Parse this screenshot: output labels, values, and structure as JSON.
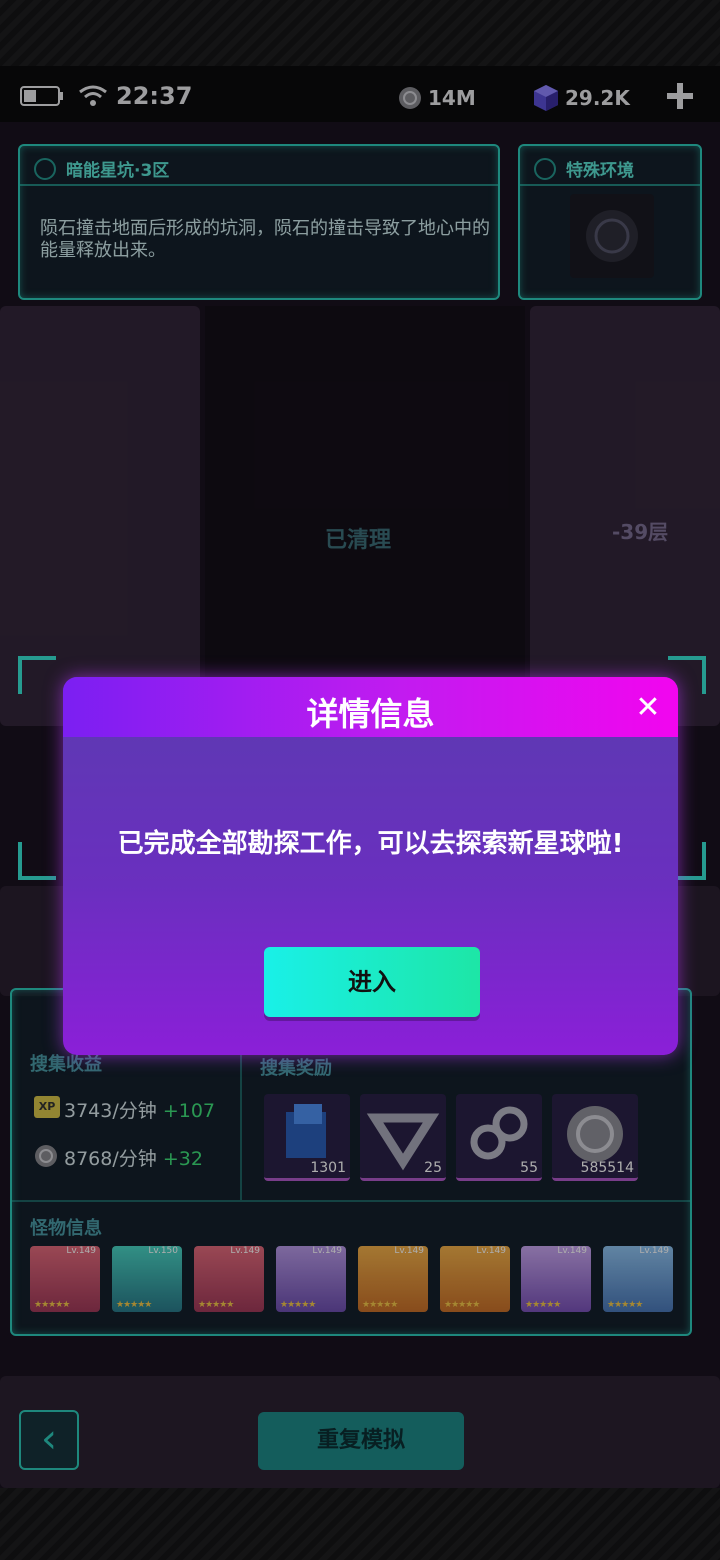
{
  "status_bar": {
    "time": "22:37",
    "coins": "14M",
    "gems": "29.2K",
    "add_icon": "plus-icon",
    "wifi_icon": "wifi-icon",
    "battery_icon": "battery-icon"
  },
  "zone_panel": {
    "title": "暗能星坑·3区",
    "description": "陨石撞击地面后形成的坑洞，陨石的撞击导致了地心中的能量释放出来。"
  },
  "env_panel": {
    "title": "特殊环境"
  },
  "map": {
    "cleared_label": "已清理",
    "floor_label": "-39层"
  },
  "collect_panel": {
    "income_label": "搜集收益",
    "reward_label": "搜集奖励",
    "xp_rate": "3743/分钟",
    "xp_bonus": "+107",
    "coin_rate": "8768/分钟",
    "coin_bonus": "+32",
    "rewards": [
      {
        "icon": "blue-cube-icon",
        "count": "1301"
      },
      {
        "icon": "metal-triangle-icon",
        "count": "25"
      },
      {
        "icon": "metal-infinity-icon",
        "count": "55"
      },
      {
        "icon": "silver-coin-icon",
        "count": "585514"
      }
    ],
    "monster_label": "怪物信息",
    "monsters": [
      {
        "level": "Lv.149"
      },
      {
        "level": "Lv.150"
      },
      {
        "level": "Lv.149"
      },
      {
        "level": "Lv.149"
      },
      {
        "level": "Lv.149"
      },
      {
        "level": "Lv.149"
      },
      {
        "level": "Lv.149"
      },
      {
        "level": "Lv.149"
      }
    ]
  },
  "modal": {
    "title": "详情信息",
    "close_icon": "close-icon",
    "message": "已完成全部勘探工作，可以去探索新星球啦!",
    "enter_label": "进入"
  },
  "bottom_bar": {
    "back_icon": "chevron-left-icon",
    "replay_label": "重复模拟"
  },
  "colors": {
    "accent": "#2dc9b8",
    "modal_top": "#c21bf0",
    "modal_body": "#6a2fbf",
    "button": "#19f0e8"
  }
}
